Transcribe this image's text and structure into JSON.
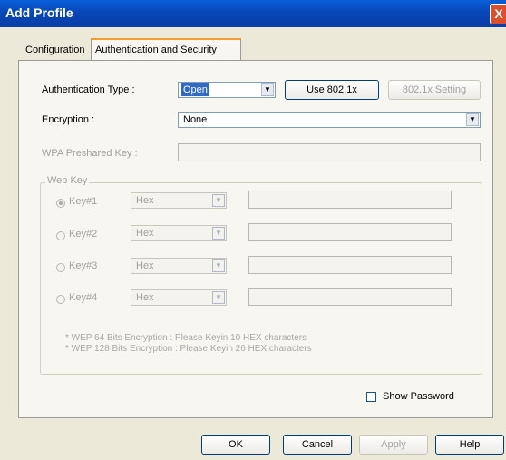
{
  "window": {
    "title": "Add Profile",
    "close_label": "X"
  },
  "tabs": [
    {
      "label": "Configuration"
    },
    {
      "label": "Authentication and Security"
    }
  ],
  "auth": {
    "auth_type_label": "Authentication Type :",
    "auth_type_value": "Open",
    "use8021x_label": "Use 802.1x",
    "setting8021x_label": "802.1x Setting",
    "encryption_label": "Encryption :",
    "encryption_value": "None",
    "wpa_label": "WPA Preshared Key :",
    "wpa_value": ""
  },
  "wep": {
    "group_label": "Wep Key",
    "keys": [
      {
        "label": "Key#1",
        "format": "Hex",
        "selected": true
      },
      {
        "label": "Key#2",
        "format": "Hex",
        "selected": false
      },
      {
        "label": "Key#3",
        "format": "Hex",
        "selected": false
      },
      {
        "label": "Key#4",
        "format": "Hex",
        "selected": false
      }
    ],
    "note1": "* WEP 64 Bits Encryption :  Please Keyin 10 HEX characters",
    "note2": "* WEP 128 Bits Encryption :  Please Keyin 26 HEX characters"
  },
  "show_password_label": "Show Password",
  "buttons": {
    "ok": "OK",
    "cancel": "Cancel",
    "apply": "Apply",
    "help": "Help"
  }
}
